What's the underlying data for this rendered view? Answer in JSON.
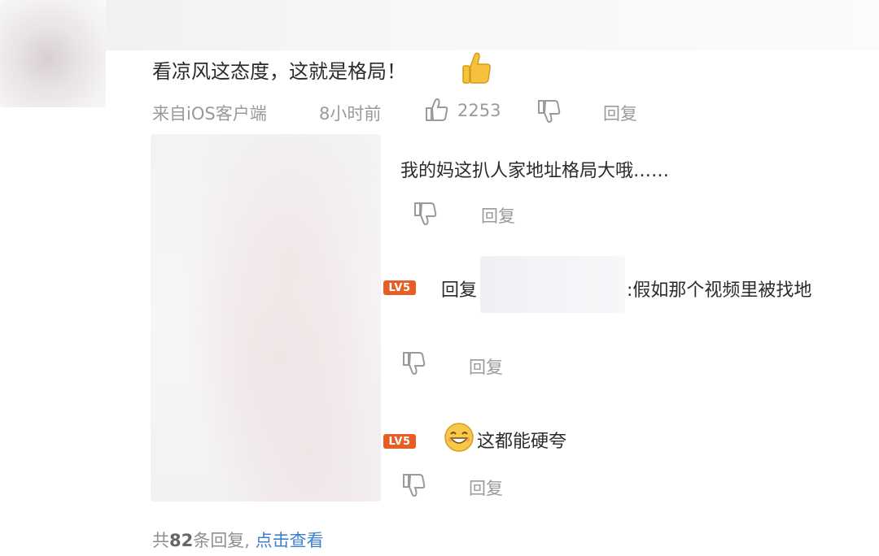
{
  "comment": {
    "text": "看凉风这态度，这就是格局！",
    "emoji": "thumbs-up",
    "source": "来自iOS客户端",
    "time": "8小时前",
    "likes": "2253",
    "reply_label": "回复"
  },
  "replies": [
    {
      "text": "我的妈这扒人家地址格局大哦……",
      "reply_label": "回复"
    },
    {
      "badge": "LV5",
      "prefix": "回复",
      "text": ":假如那个视频里被找地",
      "reply_label": "回复"
    },
    {
      "badge": "LV5",
      "emoji": "grin-face",
      "text": "这都能硬夸",
      "reply_label": "回复"
    }
  ],
  "footer": {
    "prefix": "共",
    "count": "82",
    "suffix": "条回复,",
    "link": "点击查看"
  },
  "colors": {
    "meta_gray": "#9a9a9a",
    "link_blue": "#3b7fd1",
    "badge_orange": "#e85d24"
  }
}
